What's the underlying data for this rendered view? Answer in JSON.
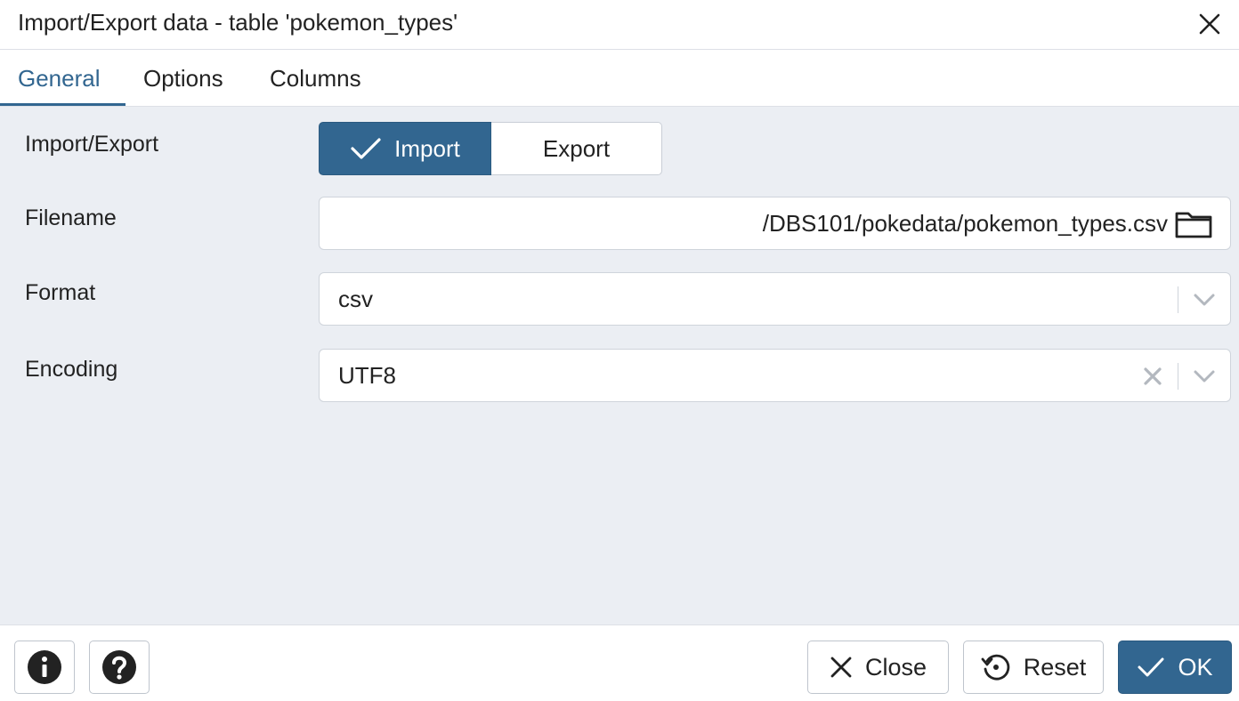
{
  "dialog": {
    "title": "Import/Export data - table 'pokemon_types'"
  },
  "tabs": [
    {
      "label": "General",
      "active": true
    },
    {
      "label": "Options",
      "active": false
    },
    {
      "label": "Columns",
      "active": false
    }
  ],
  "form": {
    "import_export": {
      "label": "Import/Export",
      "options": [
        "Import",
        "Export"
      ],
      "selected": "Import"
    },
    "filename": {
      "label": "Filename",
      "value": "/DBS101/pokedata/pokemon_types.csv",
      "visible_text": "'/DBS101/pokedata/poke"
    },
    "format": {
      "label": "Format",
      "value": "csv"
    },
    "encoding": {
      "label": "Encoding",
      "value": "UTF8"
    }
  },
  "footer": {
    "info_icon": "info-icon",
    "help_icon": "help-icon",
    "close_label": "Close",
    "reset_label": "Reset",
    "ok_label": "OK"
  },
  "colors": {
    "accent": "#326690",
    "content_bg": "#ebeef3",
    "border": "#cfd4db"
  }
}
